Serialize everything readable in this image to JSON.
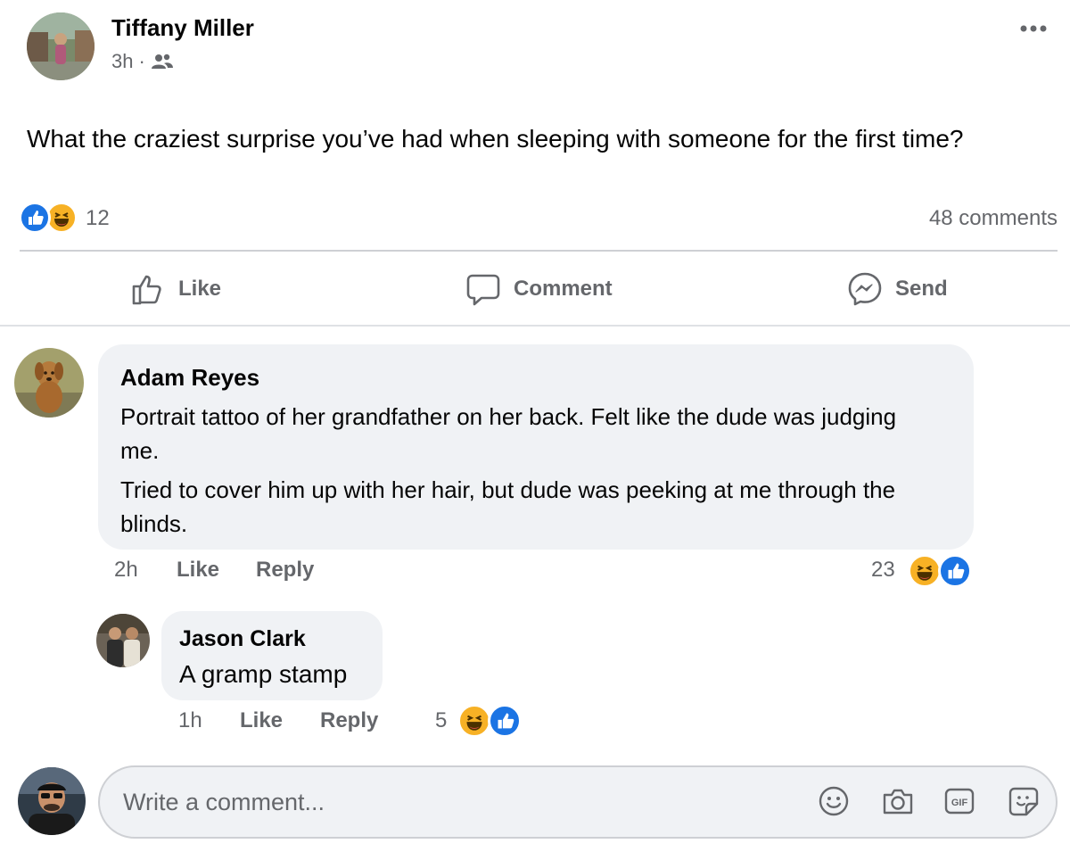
{
  "post": {
    "author": "Tiffany Miller",
    "time": "3h",
    "separator": "·",
    "audience_icon": "friends-icon",
    "text": "What the craziest surprise you’ve had when sleeping with someone for the first time?",
    "reaction_count": "12",
    "comments_count": "48 comments",
    "more_icon": "more-options-icon"
  },
  "actions": {
    "like": "Like",
    "comment": "Comment",
    "send": "Send"
  },
  "comments": [
    {
      "author": "Adam Reyes",
      "paragraph1": "Portrait tattoo of her grandfather on her back. Felt like the dude was judging me.",
      "paragraph2": "Tried to cover him up with her hair, but dude was peeking at me through the blinds.",
      "time": "2h",
      "like": "Like",
      "reply": "Reply",
      "reaction_count": "23"
    }
  ],
  "replies": [
    {
      "author": "Jason Clark",
      "text": "A gramp stamp",
      "time": "1h",
      "like": "Like",
      "reply": "Reply",
      "reaction_count": "5"
    }
  ],
  "composer": {
    "placeholder": "Write a comment...",
    "icons": [
      "emoji-icon",
      "camera-icon",
      "gif-icon",
      "sticker-icon"
    ],
    "gif_label": "GIF"
  },
  "colors": {
    "like_blue": "#1b74e4",
    "haha_yellow": "#f7b125",
    "bubble_gray": "#f0f2f5",
    "muted_text": "#65676b"
  }
}
